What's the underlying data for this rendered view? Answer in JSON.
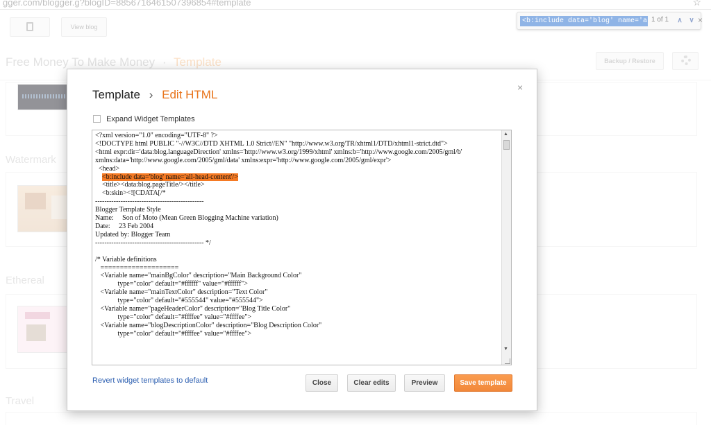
{
  "browser": {
    "url": "gger.com/blogger.g?blogID=8856716461507396854#template",
    "find": {
      "query": "<b:include data='blog' name='all-head-",
      "count": "1 of 1"
    }
  },
  "toolbar": {
    "view_blog_label": "View blog"
  },
  "header": {
    "blog_name": "Free Money To Make Money",
    "separator": "·",
    "section": "Template",
    "backup_label": "Backup / Restore"
  },
  "templates": [
    {
      "label": "Watermark"
    },
    {
      "label": "Ethereal"
    },
    {
      "label": "Travel"
    }
  ],
  "modal": {
    "title": "Template",
    "title_separator": "›",
    "title_sub": "Edit HTML",
    "close_glyph": "×",
    "expand_label": "Expand Widget Templates",
    "code_lines": [
      "<?xml version=\"1.0\" encoding=\"UTF-8\" ?>",
      "<!DOCTYPE html PUBLIC \"-//W3C//DTD XHTML 1.0 Strict//EN\" \"http://www.w3.org/TR/xhtml1/DTD/xhtml1-strict.dtd\">",
      "<html expr:dir='data:blog.languageDirection' xmlns='http://www.w3.org/1999/xhtml' xmlns:b='http://www.google.com/2005/gml/b'",
      "xmlns:data='http://www.google.com/2005/gml/data' xmlns:expr='http://www.google.com/2005/gml/expr'>",
      "  <head>",
      "    <b:include data='blog' name='all-head-content'/>",
      "    <title><data:blog.pageTitle/></title>",
      "    <b:skin><![CDATA[/*",
      "-----------------------------------------------",
      "Blogger Template Style",
      "Name:     Son of Moto (Mean Green Blogging Machine variation)",
      "Date:     23 Feb 2004",
      "Updated by: Blogger Team",
      "----------------------------------------------- */",
      "",
      "/* Variable definitions",
      "   ====================",
      "   <Variable name=\"mainBgColor\" description=\"Main Background Color\"",
      "             type=\"color\" default=\"#ffffff\" value=\"#ffffff\">",
      "   <Variable name=\"mainTextColor\" description=\"Text Color\"",
      "             type=\"color\" default=\"#555544\" value=\"#555544\">",
      "   <Variable name=\"pageHeaderColor\" description=\"Blog Title Color\"",
      "             type=\"color\" default=\"#ffffee\" value=\"#ffffee\">",
      "   <Variable name=\"blogDescriptionColor\" description=\"Blog Description Color\"",
      "             type=\"color\" default=\"#ffffee\" value=\"#ffffee\">"
    ],
    "highlight_line": 5,
    "revert_label": "Revert widget templates to default",
    "buttons": {
      "close": "Close",
      "clear": "Clear edits",
      "preview": "Preview",
      "save": "Save template"
    }
  },
  "colors": {
    "accent": "#e8731a",
    "save_button": "#f2883a",
    "highlight": "#f57a24",
    "find_selection": "#3477d1",
    "link": "#2a5db0"
  }
}
